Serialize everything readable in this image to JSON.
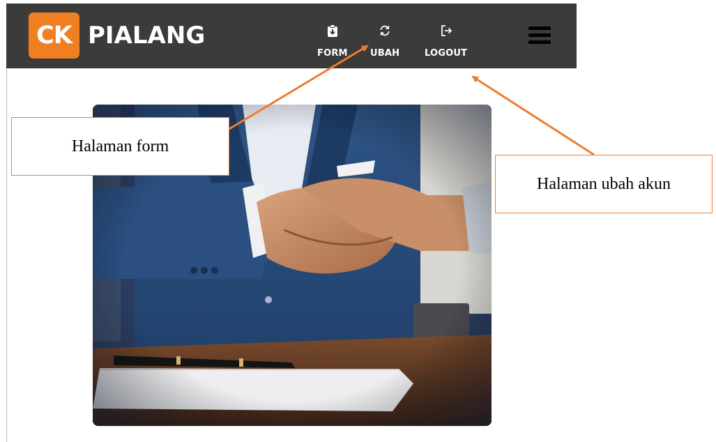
{
  "navbar": {
    "logo_badge": "CK",
    "logo_text": "PIALANG",
    "items": [
      {
        "label": "FORM",
        "icon": "clipboard-download-icon"
      },
      {
        "label": "UBAH",
        "icon": "refresh-icon"
      },
      {
        "label": "LOGOUT",
        "icon": "logout-icon"
      }
    ],
    "menu_icon": "hamburger-menu-icon"
  },
  "annotations": {
    "form_page": "Halaman form",
    "change_account_page": "Halaman ubah akun"
  },
  "colors": {
    "navbar_bg": "#3b3b39",
    "brand_orange": "#f07f22",
    "callout_border": "#ed7d31"
  }
}
